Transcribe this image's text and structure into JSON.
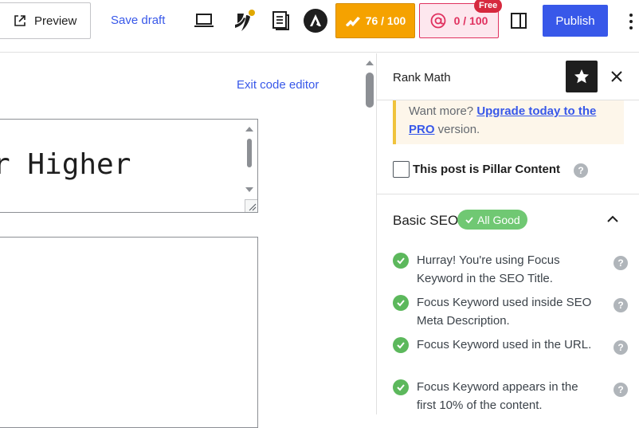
{
  "toolbar": {
    "preview_label": "Preview",
    "save_draft_label": "Save draft",
    "seo_score": "76 / 100",
    "content_ai_score": "0 / 100",
    "free_badge": "Free",
    "publish_label": "Publish"
  },
  "editor": {
    "exit_code_editor": "Exit code editor",
    "title_fragment": "r Higher"
  },
  "sidebar": {
    "title": "Rank Math",
    "notice_prefix": "Want more? ",
    "notice_link": "Upgrade today to the PRO",
    "notice_suffix": " version.",
    "pillar_label": "This post is Pillar Content",
    "basic_seo": {
      "title": "Basic SEO",
      "badge": "All Good",
      "items": [
        {
          "text": "Hurray! You're using Focus Keyword in the SEO Title."
        },
        {
          "text": "Focus Keyword used inside SEO Meta Description."
        },
        {
          "text": "Focus Keyword used in the URL."
        },
        {
          "text": "Focus Keyword appears in the first 10% of the content."
        }
      ]
    }
  },
  "colors": {
    "accent": "#3858e9",
    "seo_score_bg": "#f5a200",
    "content_ai": "#e0315f",
    "good": "#5cb85c",
    "badge_good": "#70c873"
  },
  "icons": [
    "external-link-icon",
    "laptop-icon",
    "yoast-icon",
    "document-icon",
    "astra-icon",
    "rank-math-icon",
    "content-ai-icon",
    "sidebar-toggle-icon",
    "kebab-icon",
    "star-icon",
    "close-icon",
    "help-icon",
    "check-icon",
    "chevron-up-icon"
  ]
}
